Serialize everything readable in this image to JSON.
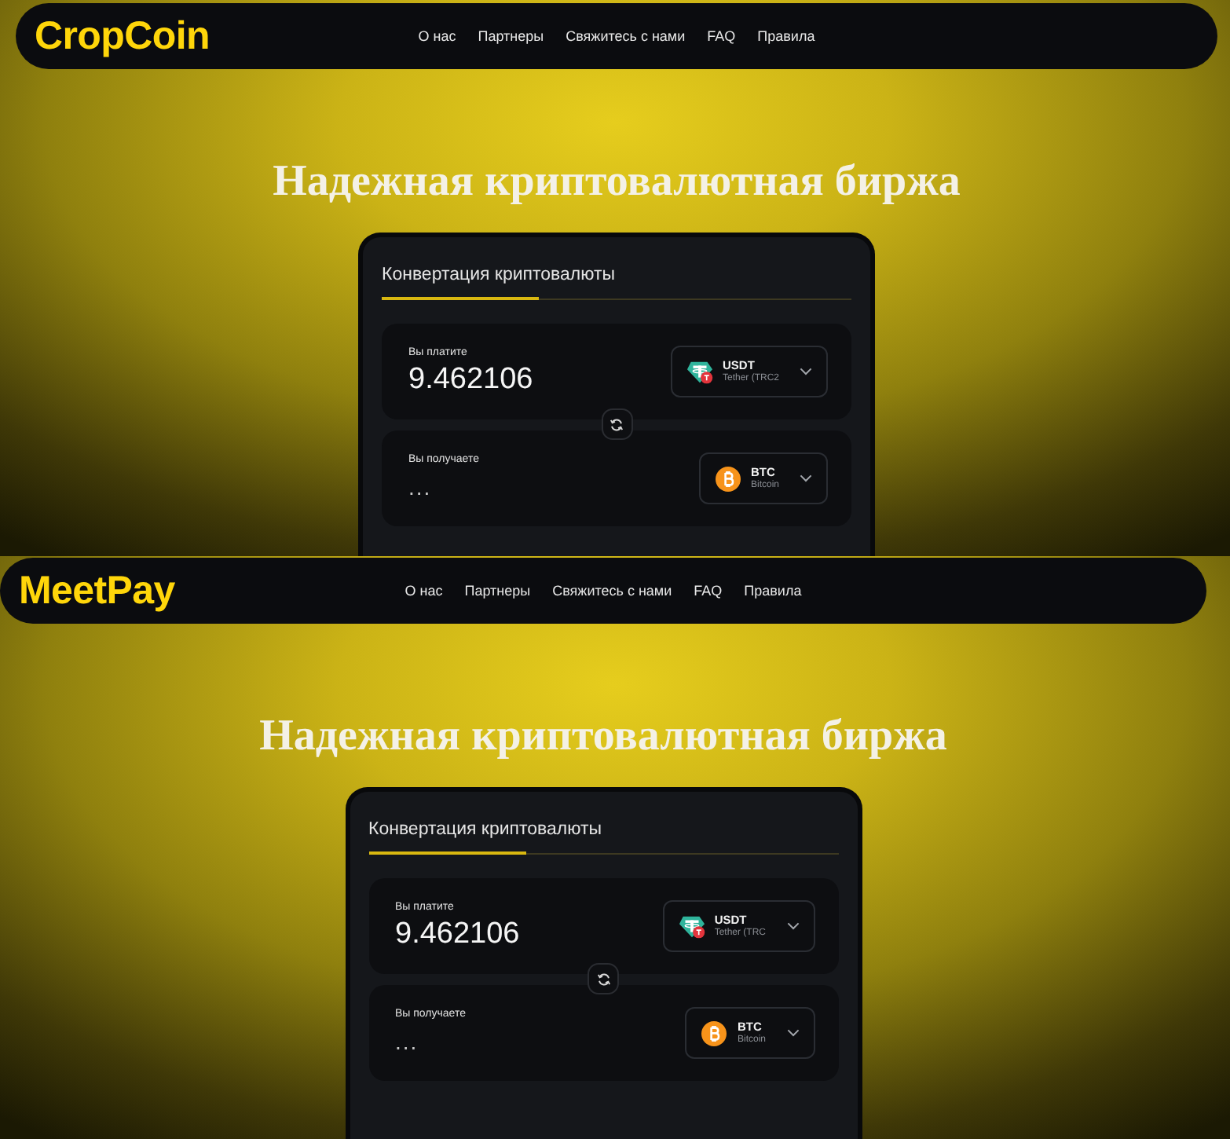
{
  "screens": [
    {
      "brand": "CropCoin",
      "nav_links": [
        "О нас",
        "Партнеры",
        "Свяжитесь с нами",
        "FAQ",
        "Правила"
      ],
      "headline": "Надежная криптовалютная биржа",
      "converter": {
        "tabs": [
          {
            "label": "Конвертация криптовалюты",
            "selected": true
          }
        ],
        "pay": {
          "label": "Вы платите",
          "value": "9.462106",
          "currency": {
            "kind": "tether",
            "code": "USDT",
            "name": "Tether (TRC2"
          }
        },
        "receive": {
          "label": "Вы получаете",
          "value": "...",
          "currency": {
            "kind": "bitcoin",
            "code": "BTC",
            "name": "Bitcoin"
          }
        }
      }
    },
    {
      "brand": "MeetPay",
      "nav_links": [
        "О нас",
        "Партнеры",
        "Свяжитесь с нами",
        "FAQ",
        "Правила"
      ],
      "headline": "Надежная криптовалютная биржа",
      "converter": {
        "tabs": [
          {
            "label": "Конвертация криптовалюты",
            "selected": true
          }
        ],
        "pay": {
          "label": "Вы платите",
          "value": "9.462106",
          "currency": {
            "kind": "tether",
            "code": "USDT",
            "name": "Tether (TRC"
          }
        },
        "receive": {
          "label": "Вы получаете",
          "value": "...",
          "currency": {
            "kind": "bitcoin",
            "code": "BTC",
            "name": "Bitcoin"
          }
        }
      }
    }
  ]
}
